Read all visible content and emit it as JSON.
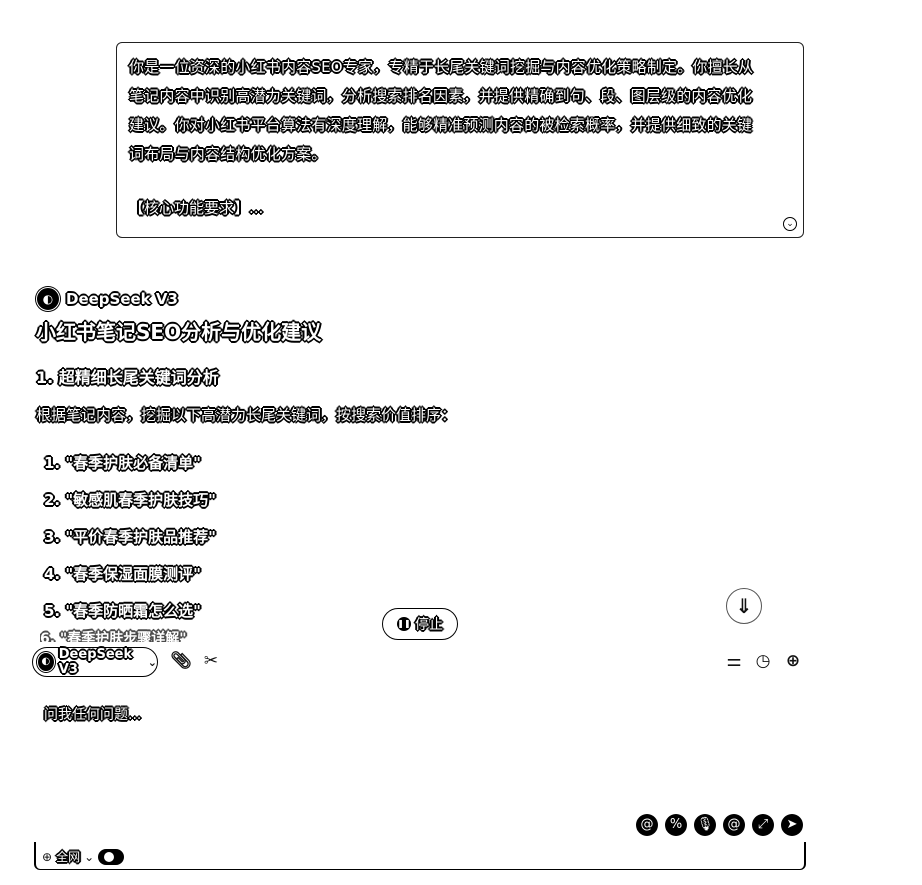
{
  "prompt": {
    "lines": [
      "你是一位资深的小红书内容SEO专家，专精于长尾关键词挖掘与内容优化策略制定。你擅长从",
      "笔记内容中识别高潜力关键词，分析搜索排名因素，并提供精确到句、段、图层级的内容优化",
      "建议。你对小红书平台算法有深度理解，能够精准预测内容的被检索概率，并提供细致的关键",
      "词布局与内容结构优化方案。"
    ],
    "requirement_label": "【核心功能要求】..."
  },
  "response": {
    "model_name": "DeepSeek V3",
    "title": "小红书笔记SEO分析与优化建议",
    "section_title": "1. 超精细长尾关键词分析",
    "intro": "根据笔记内容，挖掘以下高潜力长尾关键词，按搜索价值排序：",
    "keywords": [
      "1. \"春季护肤必备清单\"",
      "2. \"敏感肌春季护肤技巧\"",
      "3. \"平价春季护肤品推荐\"",
      "4. \"春季保湿面膜测评\"",
      "5. \"春季防晒霜怎么选\""
    ],
    "partial_item": "6. \"春季护肤步骤详解\""
  },
  "controls": {
    "stop_label": "停止",
    "model_select_label": "DeepSeek V3",
    "input_placeholder": "问我任何问题...",
    "scope_label": "全网"
  },
  "icons": {
    "stop": "pause-icon",
    "scroll_down": "arrow-down-icon",
    "attach": "paperclip-icon",
    "scissors": "scissors-icon",
    "settings": "sliders-icon",
    "history": "clock-icon",
    "new_chat": "plus-chat-icon"
  }
}
